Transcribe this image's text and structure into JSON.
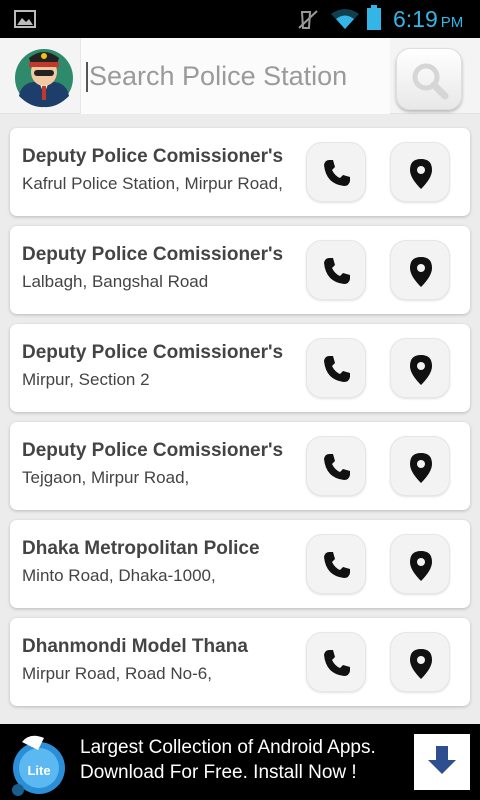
{
  "status_bar": {
    "time": "6:19",
    "ampm": "PM",
    "accent_color": "#33b5e5",
    "icons": [
      "image-icon",
      "mute-icon",
      "wifi-icon",
      "battery-icon"
    ]
  },
  "header": {
    "search_placeholder": "Search Police Station",
    "avatar_icon": "police-officer-avatar",
    "search_button_icon": "search-icon"
  },
  "stations": [
    {
      "name": "Deputy Police Comissioner's",
      "address": "Kafrul Police Station, Mirpur Road,"
    },
    {
      "name": "Deputy Police Comissioner's",
      "address": "Lalbagh, Bangshal Road"
    },
    {
      "name": "Deputy Police Comissioner's",
      "address": "Mirpur, Section 2"
    },
    {
      "name": "Deputy Police Comissioner's",
      "address": "Tejgaon, Mirpur Road,"
    },
    {
      "name": "Dhaka Metropolitan Police",
      "address": "Minto Road, Dhaka-1000,"
    },
    {
      "name": "Dhanmondi Model Thana",
      "address": "Mirpur Road, Road No-6,"
    }
  ],
  "row_actions": {
    "call_icon": "phone-icon",
    "map_icon": "location-pin-icon"
  },
  "ad": {
    "line1": "Largest Collection of Android Apps.",
    "line2": "Download For Free. Install Now !",
    "logo_badge": "Lite",
    "download_icon": "download-arrow-icon"
  }
}
